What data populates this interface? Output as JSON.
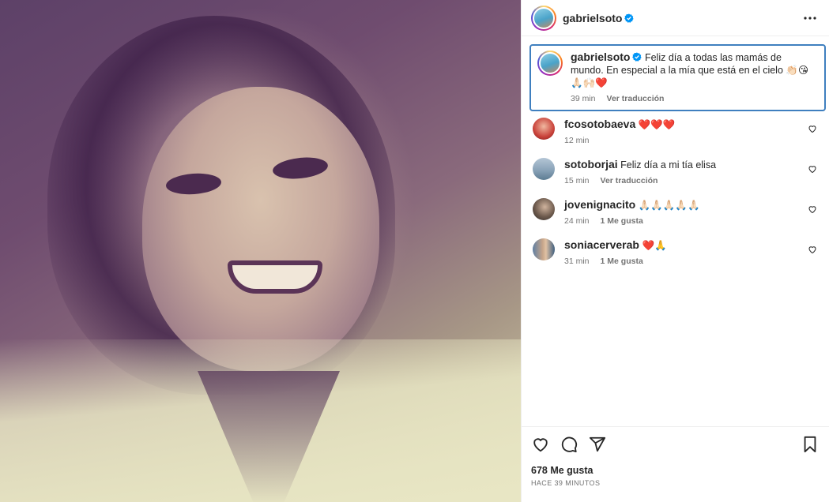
{
  "post": {
    "username": "gabrielsoto",
    "caption": "Feliz día a todas las mamás de mundo. En especial a la mía que está en el cielo 👏🏻😘🙏🏻🙌🏻❤️",
    "caption_time": "39 min",
    "caption_translate": "Ver traducción"
  },
  "comments": [
    {
      "username": "fcosotobaeva",
      "text": "❤️❤️❤️",
      "time": "12 min",
      "action": ""
    },
    {
      "username": "sotoborjai",
      "text": "Feliz día a mi tía elisa",
      "time": "15 min",
      "action": "Ver traducción"
    },
    {
      "username": "jovenignacito",
      "text": "🙏🏻🙏🏻🙏🏻🙏🏻🙏🏻",
      "time": "24 min",
      "action": "1 Me gusta"
    },
    {
      "username": "soniacerverab",
      "text": "❤️🙏",
      "time": "31 min",
      "action": "1 Me gusta"
    }
  ],
  "footer": {
    "likes": "678 Me gusta",
    "posted": "HACE 39 MINUTOS"
  },
  "icons": [
    "more-icon",
    "verified-badge-icon",
    "heart-icon",
    "comment-icon",
    "share-icon",
    "bookmark-icon"
  ],
  "colors": {
    "verified": "#0095f6",
    "caption_highlight": "#3f7fbf",
    "secondary_text": "#737373"
  }
}
